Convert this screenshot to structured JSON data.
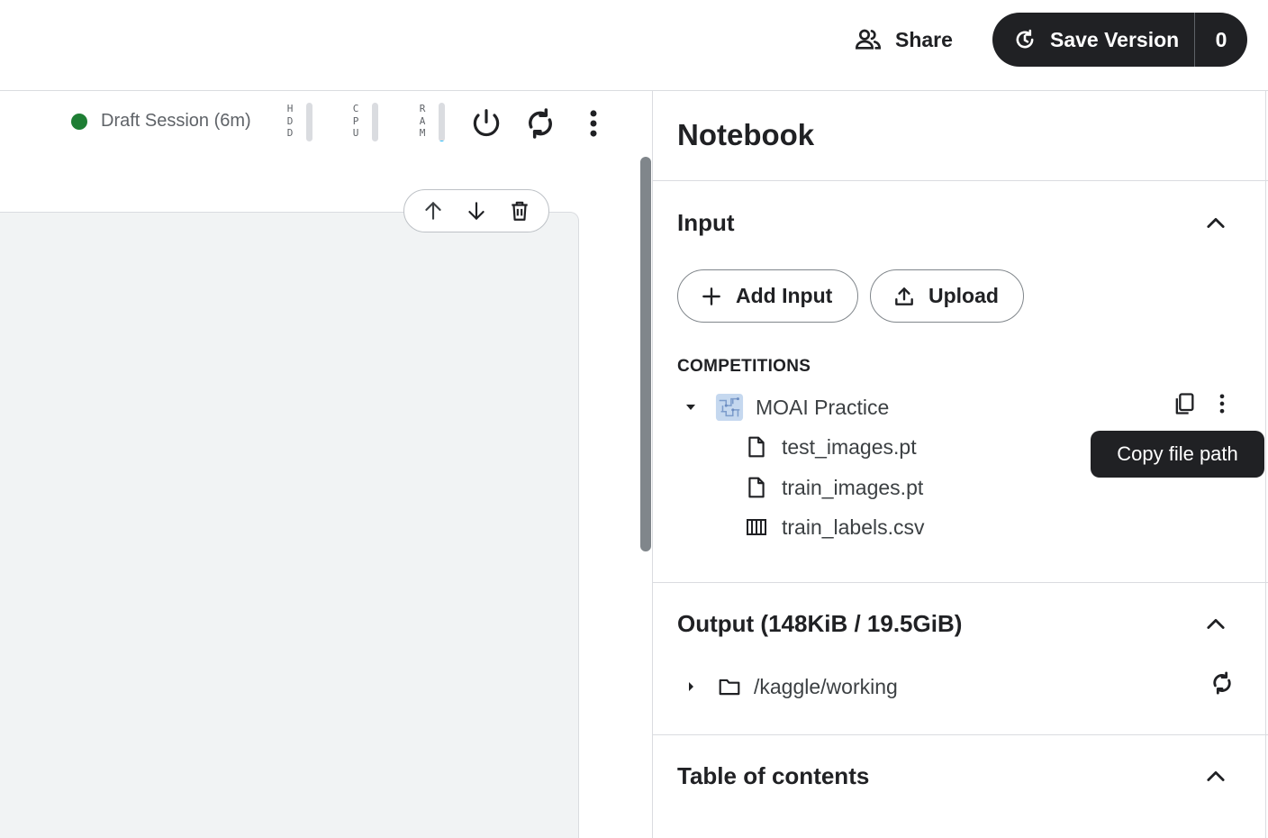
{
  "header": {
    "share_label": "Share",
    "save_version_label": "Save Version",
    "save_version_count": "0"
  },
  "session": {
    "status_color": "#1e7e34",
    "label": "Draft Session (6m)",
    "meters": [
      {
        "letters": [
          "H",
          "D",
          "D"
        ],
        "usage": 0.0
      },
      {
        "letters": [
          "C",
          "P",
          "U"
        ],
        "usage": 0.0
      },
      {
        "letters": [
          "R",
          "A",
          "M"
        ],
        "usage": 0.03
      }
    ],
    "icons": [
      "power-icon",
      "restart-icon",
      "more-vert-icon"
    ]
  },
  "cell_toolbar": {
    "icons": [
      "arrow-up-icon",
      "arrow-down-icon",
      "trash-icon"
    ]
  },
  "panel": {
    "title": "Notebook",
    "input": {
      "title": "Input",
      "add_input_label": "Add Input",
      "upload_label": "Upload",
      "category_label": "COMPETITIONS",
      "dataset": {
        "name": "MOAI Practice",
        "files": [
          {
            "name": "test_images.pt",
            "icon": "file-icon"
          },
          {
            "name": "train_images.pt",
            "icon": "file-icon"
          },
          {
            "name": "train_labels.csv",
            "icon": "table-icon"
          }
        ]
      },
      "tooltip": "Copy file path"
    },
    "output": {
      "title": "Output (148KiB / 19.5GiB)",
      "folder": "/kaggle/working"
    },
    "toc": {
      "title": "Table of contents"
    }
  },
  "colors": {
    "primary_dark": "#202124",
    "text_secondary": "#5f6368",
    "border": "#dadce0",
    "cell_bg": "#f1f3f4"
  }
}
